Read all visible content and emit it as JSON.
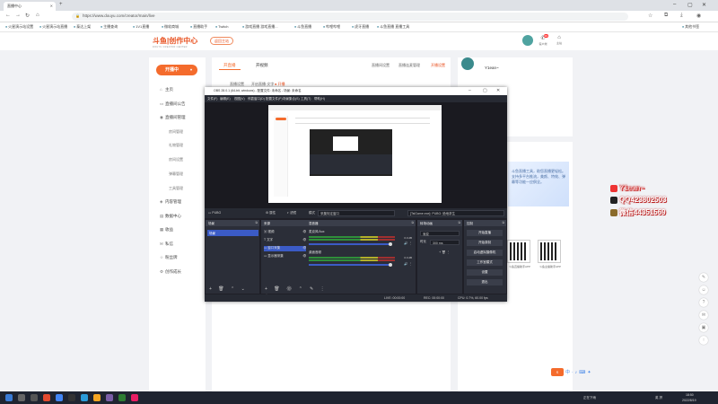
{
  "browser": {
    "tab_title": "直播中心",
    "url": "https://www.douyu.com/creator/main/live",
    "bookmarks": [
      "火星演示站设置",
      "火星演示站直播",
      "泰达上架",
      "主播查询",
      "1V1直播",
      "微软商城",
      "直播助手",
      "Twitch",
      "游戏直播 游戏直播...",
      "斗鱼直播",
      "哔哩哔哩",
      "虎牙直播",
      "斗鱼直播 直播工具",
      "其他书签"
    ]
  },
  "site": {
    "logo_text": "斗鱼|创作中心",
    "logo_sub": "DOUYU CREATOR CENTER",
    "back_btn": "返回主站",
    "header_icons": [
      {
        "name": "messages",
        "label": "客户端",
        "badge": "99"
      },
      {
        "name": "home",
        "label": "主站"
      }
    ]
  },
  "sidebar": {
    "start_btn": "开播中",
    "menu": [
      {
        "icon": "⌂",
        "label": "主页"
      },
      {
        "icon": "▭",
        "label": "直播间公告"
      },
      {
        "icon": "◉",
        "label": "直播间管理"
      }
    ],
    "sub": [
      "房间管理",
      "礼物管理",
      "房间设置",
      "弹幕管理",
      "工具管理"
    ],
    "menu2": [
      {
        "icon": "◈",
        "label": "内容管理"
      },
      {
        "icon": "▤",
        "label": "数据中心"
      },
      {
        "icon": "▦",
        "label": "收益"
      },
      {
        "icon": "✉",
        "label": "私信"
      },
      {
        "icon": "☆",
        "label": "粉丝牌"
      },
      {
        "icon": "⚙",
        "label": "创作成长"
      }
    ]
  },
  "main": {
    "tabs": [
      "开直播",
      "开视频"
    ],
    "links": [
      "直播间设置",
      "直播连麦管理",
      "开播设置"
    ],
    "crumbs": [
      "直播设置",
      "开启直播·文字",
      "● 开播"
    ]
  },
  "profile": {
    "name": "Y1ean~"
  },
  "promo": {
    "text": "斗鱼直播工具，助您直播更轻松。支持多平台推流，美颜、特效、弹幕等功能一应俱全。",
    "qr_captions": [
      "斗鱼直播助手APP",
      "斗鱼主播助手APP"
    ]
  },
  "overlay": {
    "name": "Y1ean~",
    "qq_label": "QQ",
    "qq": "423802503",
    "wechat_label": "微信",
    "wechat": "44351569"
  },
  "obs": {
    "title": "OBS 28.0.1 (64-bit, windows) - 配置文件: 未命名 - 场景: 未命名",
    "menus": [
      "文件(F)",
      "编辑(E)",
      "视图(V)",
      "停靠窗口(D)",
      "配置文件(P)",
      "场景集合(S)",
      "工具(T)",
      "帮助(H)"
    ],
    "scene_bar": {
      "scene_name": "PUBG",
      "props": "属性",
      "filter": "滤镜",
      "mode_label": "模式",
      "mode_value": "采集特定窗口",
      "window_value": "[TslGame.exe]: PUBG: 绝地求生"
    },
    "docks": {
      "scenes": {
        "title": "场景",
        "items": [
          "场景"
        ]
      },
      "sources": {
        "title": "来源",
        "items": [
          "视频",
          "文字",
          "窗口采集",
          "显示器采集"
        ]
      },
      "mixer": {
        "title": "混音器",
        "channels": [
          {
            "name": "桌面音频",
            "db": "0.0 dB"
          },
          {
            "name": "麦克风/Aux",
            "db": "0.0 dB"
          }
        ]
      },
      "transitions": {
        "title": "转场动画",
        "type": "渐变",
        "duration_label": "时长",
        "duration": "300 ms"
      },
      "controls": {
        "title": "控制",
        "buttons": [
          "开始直播",
          "开始录制",
          "启动虚拟摄像机",
          "工作室模式",
          "设置",
          "退出"
        ]
      }
    },
    "status": {
      "live": "LIVE: 00:00:00",
      "rec": "REC: 00:00:00",
      "cpu": "CPU: 0.7%, 60.00 fps"
    }
  },
  "taskbar": {
    "tray_text": "英 拼",
    "time": "18:50",
    "date": "2022/8/19",
    "weather": "正在下雨"
  },
  "colors": {
    "accent": "#f46b2c",
    "obs_bg": "#1f1f27",
    "obs_select": "#3b5bc6"
  }
}
